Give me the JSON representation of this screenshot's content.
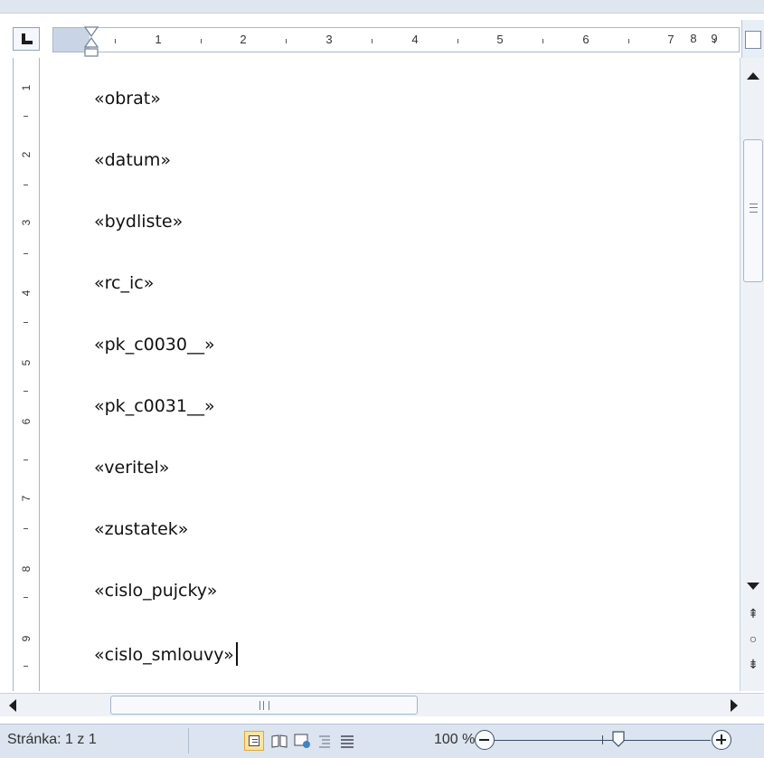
{
  "ruler": {
    "horizontal_numbers": [
      "1",
      "2",
      "3",
      "4",
      "5",
      "6",
      "7",
      "8",
      "9"
    ],
    "vertical_numbers": [
      "1",
      "2",
      "3",
      "4",
      "5",
      "6",
      "7",
      "8",
      "9"
    ]
  },
  "document": {
    "fields": [
      "«obrat»",
      "«datum»",
      "«bydliste»",
      "«rc_ic»",
      "«pk_c0030__»",
      "«pk_c0031__»",
      "«veritel»",
      "«zustatek»",
      "«cislo_pujcky»",
      "«cislo_smlouvy»"
    ]
  },
  "scrollbar": {
    "browse_prev_icon": "double-up-arrow-icon",
    "browse_object_icon": "circle-icon",
    "browse_next_icon": "double-down-arrow-icon"
  },
  "status_bar": {
    "page_info": "Stránka: 1 z 1",
    "zoom_level": "100 %",
    "active_view": "print-layout"
  },
  "colors": {
    "chrome": "#dbe4ef",
    "active_view_highlight": "#fbe3a0"
  }
}
